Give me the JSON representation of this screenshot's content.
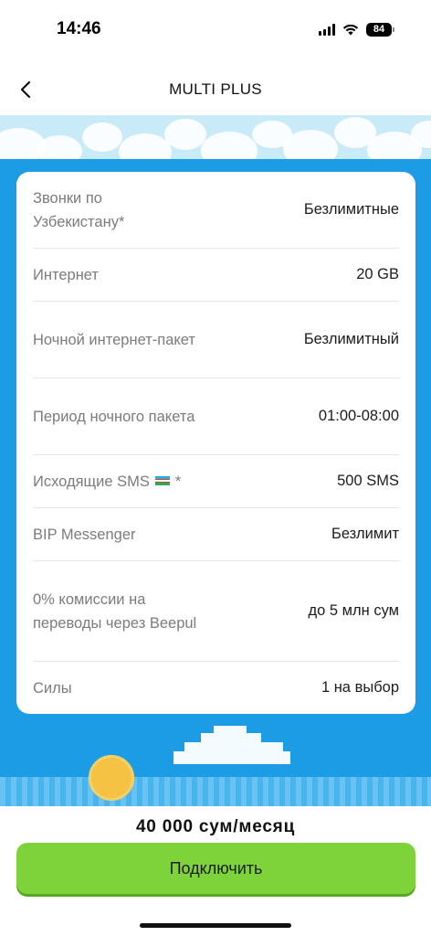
{
  "status_bar": {
    "time": "14:46",
    "battery": "84",
    "icons": [
      "signal-icon",
      "wifi-icon",
      "battery-icon"
    ]
  },
  "nav": {
    "title": "MULTI PLUS",
    "back_icon": "chevron-left-icon"
  },
  "details": [
    {
      "label": "Звонки по Узбекистану*",
      "value": "Безлимитные"
    },
    {
      "label": "Интернет",
      "value": "20 GB"
    },
    {
      "label": "Ночной интернет-пакет",
      "value": "Безлимитный"
    },
    {
      "label": "Период ночного пакета",
      "value": "01:00-08:00"
    },
    {
      "label": "Исходящие SMS",
      "label_suffix": "*",
      "value": "500 SMS",
      "icon": "uzbekistan-flag-icon"
    },
    {
      "label": "BIP Messenger",
      "value": "Безлимит"
    },
    {
      "label": "0% комиссии на переводы через Beepul",
      "value": "до 5 млн сум"
    },
    {
      "label": "Силы",
      "value": "1 на выбор"
    }
  ],
  "footer": {
    "price": "40 000  сум/месяц",
    "connect_label": "Подключить"
  },
  "colors": {
    "sky": "#1d9ce6",
    "button": "#7fd33a",
    "label_text": "#7b7b80"
  }
}
